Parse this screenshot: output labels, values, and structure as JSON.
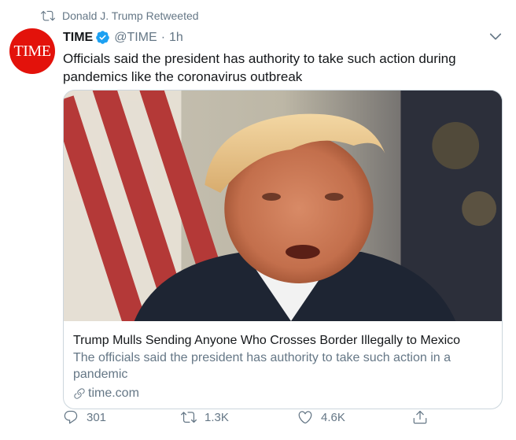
{
  "retweet_context": {
    "text": "Donald J. Trump Retweeted",
    "icon": "retweet-icon"
  },
  "author": {
    "avatar_text": "TIME",
    "avatar_color": "#e3120b",
    "name": "TIME",
    "verified": true,
    "handle": "@TIME",
    "separator": "·",
    "time": "1h"
  },
  "tweet": {
    "text": "Officials said the president has authority to take such action during pandemics like the coronavirus outbreak"
  },
  "card": {
    "image_desc": "photo",
    "title": "Trump Mulls Sending Anyone Who Crosses Border Illegally to Mexico",
    "description": "The officials said the president has authority to take such action in a pandemic",
    "domain": "time.com"
  },
  "actions": {
    "replies": "301",
    "retweets": "1.3K",
    "likes": "4.6K"
  },
  "colors": {
    "text_primary": "#14171a",
    "text_secondary": "#657786",
    "verified_blue": "#1da1f2",
    "border": "#ccd6dd"
  }
}
